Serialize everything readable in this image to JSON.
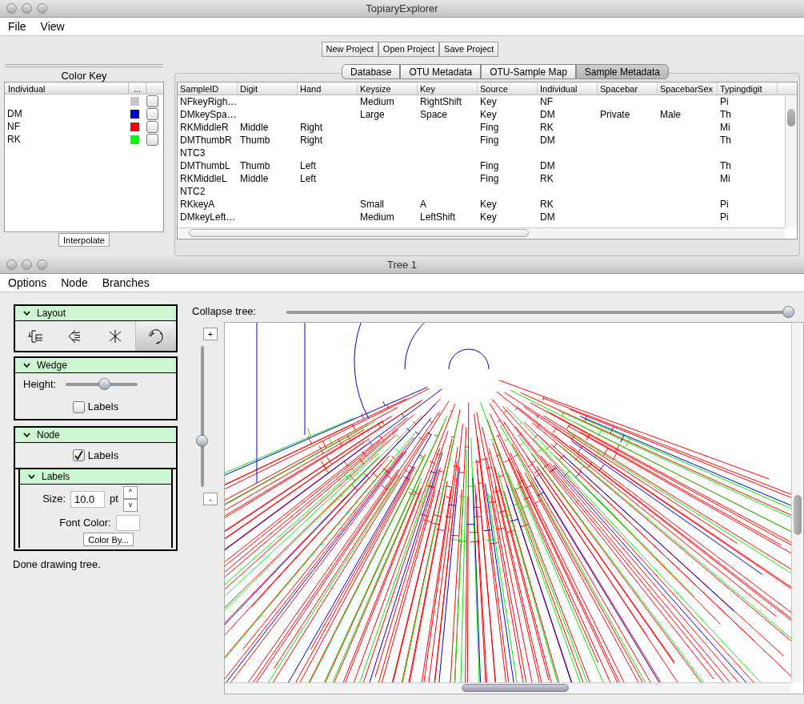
{
  "main_window": {
    "title": "TopiaryExplorer",
    "menu": [
      "File",
      "View"
    ],
    "project_buttons": [
      "New Project",
      "Open Project",
      "Save Project"
    ],
    "color_key": {
      "title": "Color Key",
      "columns": [
        "Individual",
        "..."
      ],
      "items": [
        {
          "color": "#c8c8c8",
          "checked": false
        },
        {
          "label": "DM",
          "color": "#0000cc",
          "checked": false
        },
        {
          "label": "NF",
          "color": "#ff0000",
          "checked": false
        },
        {
          "label": "RK",
          "color": "#00ff00",
          "checked": false
        }
      ],
      "button": "Interpolate"
    },
    "tabs": [
      {
        "label": "Database",
        "selected": false
      },
      {
        "label": "OTU Metadata",
        "selected": false
      },
      {
        "label": "OTU-Sample Map",
        "selected": false
      },
      {
        "label": "Sample Metadata",
        "selected": true
      }
    ],
    "table": {
      "columns": [
        "SampleID",
        "Digit",
        "Hand",
        "Keysize",
        "Key",
        "Source",
        "Individual",
        "Spacebar",
        "SpacebarSex",
        "Typingdigit"
      ],
      "rows": [
        [
          "NFkeyRigh…",
          "",
          "",
          "Medium",
          "RightShift",
          "Key",
          "NF",
          "",
          "",
          "Pi"
        ],
        [
          "DMkeySpa…",
          "",
          "",
          "Large",
          "Space",
          "Key",
          "DM",
          "Private",
          "Male",
          "Th"
        ],
        [
          "RKMiddleR",
          "Middle",
          "Right",
          "",
          "",
          "Fing",
          "RK",
          "",
          "",
          "Mi"
        ],
        [
          "DMThumbR",
          "Thumb",
          "Right",
          "",
          "",
          "Fing",
          "DM",
          "",
          "",
          "Th"
        ],
        [
          "NTC3",
          "",
          "",
          "",
          "",
          "",
          "",
          "",
          "",
          ""
        ],
        [
          "DMThumbL",
          "Thumb",
          "Left",
          "",
          "",
          "Fing",
          "DM",
          "",
          "",
          "Th"
        ],
        [
          "RKMiddleL",
          "Middle",
          "Left",
          "",
          "",
          "Fing",
          "RK",
          "",
          "",
          "Mi"
        ],
        [
          "NTC2",
          "",
          "",
          "",
          "",
          "",
          "",
          "",
          "",
          ""
        ],
        [
          "RKkeyA",
          "",
          "",
          "Small",
          "A",
          "Key",
          "RK",
          "",
          "",
          "Pi"
        ],
        [
          "DMkeyLeft…",
          "",
          "",
          "Medium",
          "LeftShift",
          "Key",
          "DM",
          "",
          "",
          "Pi"
        ]
      ]
    }
  },
  "tree_window": {
    "title": "Tree 1",
    "menu": [
      "Options",
      "Node",
      "Branches"
    ],
    "layout_panel": {
      "title": "Layout",
      "buttons": [
        {
          "kind": "rectangular",
          "selected": false
        },
        {
          "kind": "slanted",
          "selected": false
        },
        {
          "kind": "radial",
          "selected": false
        },
        {
          "kind": "polar",
          "selected": true
        }
      ]
    },
    "wedge_panel": {
      "title": "Wedge",
      "height_label": "Height:",
      "height": {
        "level": 0.55
      },
      "labels_checkbox": {
        "label": "Labels",
        "checked": false
      }
    },
    "node_panel": {
      "title": "Node",
      "labels_checkbox": {
        "label": "Labels",
        "checked": true
      },
      "labels_panel": {
        "title": "Labels",
        "size_label": "Size:",
        "size_value": "10.0",
        "unit": "pt",
        "up": "^",
        "down": "v",
        "font_color_label": "Font Color:",
        "color_by_button": "Color By..."
      }
    },
    "status": "Done drawing tree.",
    "collapse_label": "Collapse tree:",
    "collapse": {
      "level": 1.0
    },
    "zoom": {
      "plus": "+",
      "minus": "-",
      "level": 0.31
    }
  }
}
